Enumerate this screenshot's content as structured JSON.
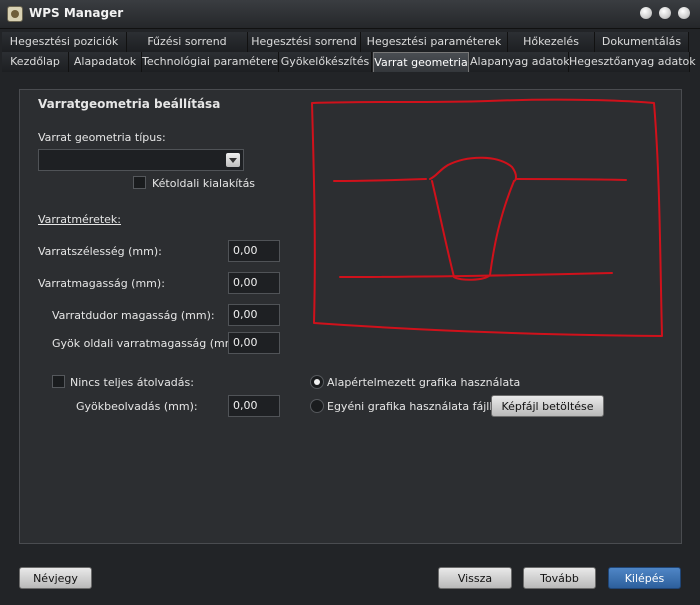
{
  "window": {
    "title": "WPS Manager"
  },
  "tabs": {
    "row1": [
      "Hegesztési poziciók",
      "Fűzési sorrend",
      "Hegesztési sorrend",
      "Hegesztési paraméterek",
      "Hőkezelés",
      "Dokumentálás"
    ],
    "row2": [
      "Kezdőlap",
      "Alapadatok",
      "Technológiai paraméterek",
      "Gyökelőkészítés",
      "Varrat geometria",
      "Alapanyag adatok",
      "Hegesztőanyag adatok"
    ],
    "active": "Varrat geometria"
  },
  "form": {
    "heading": "Varratgeometria beállítása",
    "type_label": "Varrat geometria típus:",
    "type_value": "",
    "double_sided_label": "Kétoldali kialakítás",
    "double_sided_checked": false,
    "dimensions_heading": "Varratméretek:",
    "width_label": "Varratszélesség (mm):",
    "width_value": "0,00",
    "height_label": "Varratmagasság (mm):",
    "height_value": "0,00",
    "bead_height_label": "Varratdudor magasság (mm):",
    "bead_height_value": "0,00",
    "root_height_label": "Gyök oldali varratmagasság (mm):",
    "root_height_value": "0,00",
    "no_full_penetration_label": "Nincs teljes átolvadás:",
    "no_full_penetration_checked": false,
    "root_penetration_label": "Gyökbeolvadás (mm):",
    "root_penetration_value": "0,00"
  },
  "graphics": {
    "default_label": "Alapértelmezett grafika használata",
    "default_selected": true,
    "custom_label": "Egyéni grafika használata fájlból",
    "custom_selected": false,
    "load_button": "Képfájl betöltése",
    "sketch_color": "#d0111b"
  },
  "footer": {
    "about": "Névjegy",
    "back": "Vissza",
    "next": "Tovább",
    "exit": "Kilépés"
  }
}
